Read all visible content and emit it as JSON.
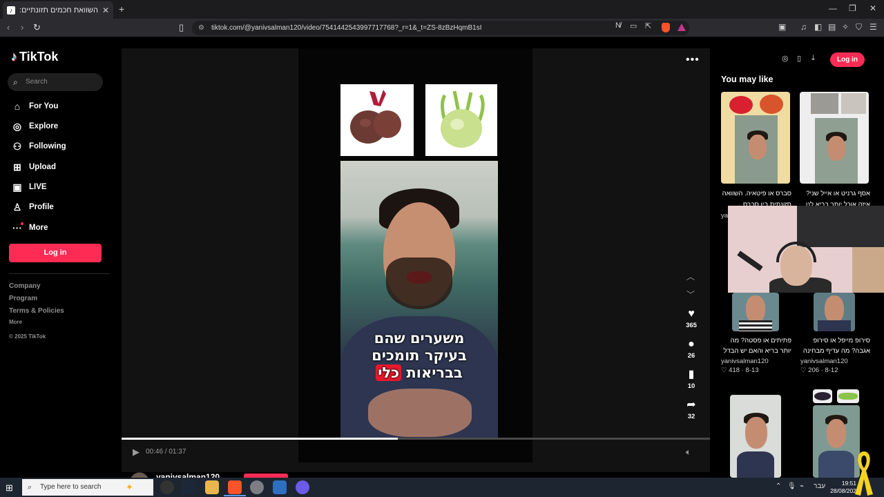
{
  "browser": {
    "tab_title": "השוואת חכמים תזונתיים: קולורבי",
    "tab_icon": "tiktok-icon",
    "url": "tiktok.com/@yanivsalman120/video/7541442543997717768?_r=1&_t=ZS-8zBzHqmB1sI"
  },
  "sidebar": {
    "logo_text": "TikTok",
    "search_placeholder": "Search",
    "nav": [
      {
        "label": "For You",
        "icon": "home-icon"
      },
      {
        "label": "Explore",
        "icon": "compass-icon"
      },
      {
        "label": "Following",
        "icon": "following-icon"
      },
      {
        "label": "Upload",
        "icon": "upload-icon"
      },
      {
        "label": "LIVE",
        "icon": "live-icon"
      },
      {
        "label": "Profile",
        "icon": "profile-icon"
      },
      {
        "label": "More",
        "icon": "more-icon"
      }
    ],
    "login_label": "Log in",
    "footer": {
      "company": "Company",
      "program": "Program",
      "terms": "Terms & Policies",
      "more": "More",
      "copyright": "© 2025 TikTok"
    }
  },
  "video": {
    "caption_line1": "משערים שהם",
    "caption_line2": "בעיקר תומכים",
    "caption_line3_a": "בבריאות",
    "caption_line3_highlight": "כלי",
    "likes": "365",
    "comments": "26",
    "saves": "10",
    "shares": "32",
    "time": "00:46 / 01:37",
    "progress_fraction": 0.47,
    "author": "yanivsalman120"
  },
  "right_panel": {
    "login_label": "Log in",
    "heading": "You may like",
    "cards": [
      {
        "title": "סברס או פיטאיה. השוואה",
        "title2": "תזונתית בין סברס...",
        "user": "ya",
        "stats": ""
      },
      {
        "title": "אסף גרניט או אייל שני?",
        "title2": "איזה אוכל יותר בריא לנו",
        "user": "",
        "stats": ""
      },
      {
        "title": "פתיתים או פסטה? מה",
        "title2": "יותר בריא והאם יש הבדל",
        "user": "yanivsalman120",
        "likes": "418",
        "date": "8-13"
      },
      {
        "title": "סירופ מייפל או סירופ",
        "title2": "אגבה? מה עדיף מבחינה",
        "user": "yanivsalman120",
        "likes": "206",
        "date": "8-12"
      }
    ]
  },
  "taskbar": {
    "search_placeholder": "Type here to search",
    "lang": "עבר",
    "time": "19:51",
    "date": "28/08/202"
  },
  "colors": {
    "tiktok_red": "#fe2c55",
    "bg": "#000000",
    "panel": "#121212"
  }
}
